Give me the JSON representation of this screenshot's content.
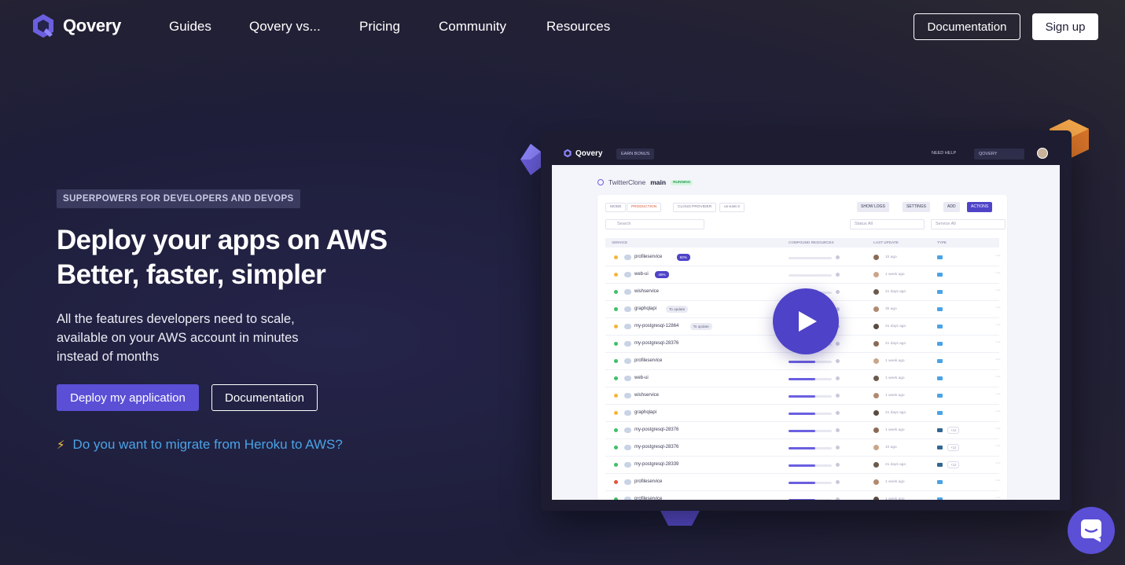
{
  "brand": {
    "name": "Qovery",
    "accent": "#5b4fd6"
  },
  "nav": {
    "links": [
      "Guides",
      "Qovery vs...",
      "Pricing",
      "Community",
      "Resources"
    ],
    "documentation_label": "Documentation",
    "signup_label": "Sign up"
  },
  "hero": {
    "eyebrow": "SUPERPOWERS FOR DEVELOPERS AND DEVOPS",
    "headline_line1": "Deploy your apps on AWS",
    "headline_line2": "Better, faster, simpler",
    "subtitle_line1": "All the features developers need to scale,",
    "subtitle_line2": "available on your AWS account in minutes",
    "subtitle_line3": "instead of months",
    "primary_cta": "Deploy my application",
    "secondary_cta": "Documentation",
    "migrate_icon": "lightning-icon",
    "migrate_link": "Do you want to migrate from Heroku to AWS?"
  },
  "mockup": {
    "app_name": "Qovery",
    "earn_bonus": "EARN BONUS",
    "need_help": "NEED HELP",
    "org": "QOVERY",
    "breadcrumb": {
      "project": "TwitterClone",
      "env": "main",
      "status": "RUNNING"
    },
    "chips": {
      "mode": "MODE",
      "production": "PRODUCTION",
      "cloud_provider": "CLOUD PROVIDER",
      "region": "us-east-2"
    },
    "toolbar": {
      "show_logs": "SHOW LOGS",
      "settings": "SETTINGS",
      "add": "ADD",
      "actions": "ACTIONS"
    },
    "search_placeholder": "Search",
    "status_filter": "Status  All",
    "service_filter": "Service  All",
    "columns": {
      "service": "SERVICE",
      "resources": "COMPOUND RESOURCES",
      "last_update": "LAST UPDATE",
      "type": "TYPE"
    },
    "rows": [
      {
        "name": "profileservice",
        "status_color": "#f5b53a",
        "pill": "93%",
        "pill_kind": "progress",
        "fill": 0,
        "updated": "1h ago",
        "type_color": "#4aa3e6",
        "extra": ""
      },
      {
        "name": "web-ui",
        "status_color": "#f5b53a",
        "pill": "46%",
        "pill_kind": "progress",
        "fill": 0,
        "updated": "1 week ago",
        "type_color": "#4aa3e6",
        "extra": ""
      },
      {
        "name": "wishservice",
        "status_color": "#3fbf6a",
        "pill": "",
        "pill_kind": "",
        "fill": 0,
        "updated": "21 days ago",
        "type_color": "#4aa3e6",
        "extra": ""
      },
      {
        "name": "graphqlapi",
        "status_color": "#3fbf6a",
        "pill": "To update",
        "pill_kind": "update",
        "fill": 0,
        "updated": "3h ago",
        "type_color": "#4aa3e6",
        "extra": ""
      },
      {
        "name": "my-postgresql-12864",
        "status_color": "#f5b53a",
        "pill": "To update",
        "pill_kind": "update",
        "fill": 0,
        "updated": "21 days ago",
        "type_color": "#4aa3e6",
        "extra": ""
      },
      {
        "name": "my-postgresql-28376",
        "status_color": "#3fbf6a",
        "pill": "",
        "pill_kind": "",
        "fill": 0,
        "updated": "21 days ago",
        "type_color": "#4aa3e6",
        "extra": ""
      },
      {
        "name": "profileservice",
        "status_color": "#3fbf6a",
        "pill": "",
        "pill_kind": "",
        "fill": 0.62,
        "updated": "1 week ago",
        "type_color": "#4aa3e6",
        "extra": ""
      },
      {
        "name": "web-ui",
        "status_color": "#3fbf6a",
        "pill": "",
        "pill_kind": "",
        "fill": 0.62,
        "updated": "1 week ago",
        "type_color": "#4aa3e6",
        "extra": ""
      },
      {
        "name": "wishservice",
        "status_color": "#f5b53a",
        "pill": "",
        "pill_kind": "",
        "fill": 0.62,
        "updated": "1 week ago",
        "type_color": "#4aa3e6",
        "extra": ""
      },
      {
        "name": "graphqlapi",
        "status_color": "#f5b53a",
        "pill": "",
        "pill_kind": "",
        "fill": 0.62,
        "updated": "21 days ago",
        "type_color": "#4aa3e6",
        "extra": ""
      },
      {
        "name": "my-postgresql-28376",
        "status_color": "#3fbf6a",
        "pill": "",
        "pill_kind": "",
        "fill": 0.62,
        "updated": "1 week ago",
        "type_color": "#336791",
        "extra": "+12"
      },
      {
        "name": "my-postgresql-28376",
        "status_color": "#3fbf6a",
        "pill": "",
        "pill_kind": "",
        "fill": 0.62,
        "updated": "1h ago",
        "type_color": "#336791",
        "extra": "+12"
      },
      {
        "name": "my-postgresql-28339",
        "status_color": "#3fbf6a",
        "pill": "",
        "pill_kind": "",
        "fill": 0.62,
        "updated": "21 days ago",
        "type_color": "#336791",
        "extra": "+12"
      },
      {
        "name": "profileservice",
        "status_color": "#e5533d",
        "pill": "",
        "pill_kind": "",
        "fill": 0.62,
        "updated": "1 week ago",
        "type_color": "#4aa3e6",
        "extra": ""
      },
      {
        "name": "profileservice",
        "status_color": "#3fbf6a",
        "pill": "",
        "pill_kind": "",
        "fill": 0.62,
        "updated": "1 week ago",
        "type_color": "#4aa3e6",
        "extra": ""
      }
    ]
  },
  "icons": {
    "play": "play-icon",
    "chat": "chat-icon"
  }
}
